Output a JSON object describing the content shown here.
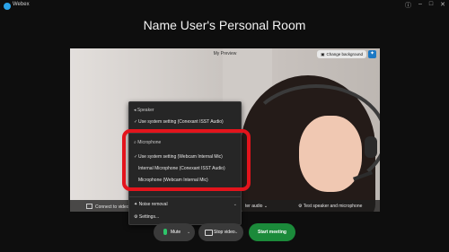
{
  "app": {
    "name": "Webex",
    "title": "Name User's Personal Room"
  },
  "preview": {
    "label": "My Preview",
    "change_background": "Change background",
    "dock": {
      "connect_label": "Connect to video",
      "audio_label": "ter audio",
      "test_label": "Test speaker and microphone"
    }
  },
  "audio_menu": {
    "speaker_header": "Speaker",
    "speaker_items": [
      "Use system setting (Conexant ISST Audio)"
    ],
    "microphone_header": "Microphone",
    "microphone_items": [
      "Use system setting (Webcam Internal Mic)",
      "Internal Microphone (Conexant ISST Audio)",
      "Microphone (Webcam Internal Mic)"
    ],
    "noise_removal": "Noise removal",
    "settings": "Settings..."
  },
  "controls": {
    "mute": "Mute",
    "stop_video": "Stop video",
    "start_meeting": "Start meeting"
  },
  "colors": {
    "accent": "#1b8a3a",
    "highlight": "#e3141c",
    "mic_active": "#2ec56a"
  }
}
